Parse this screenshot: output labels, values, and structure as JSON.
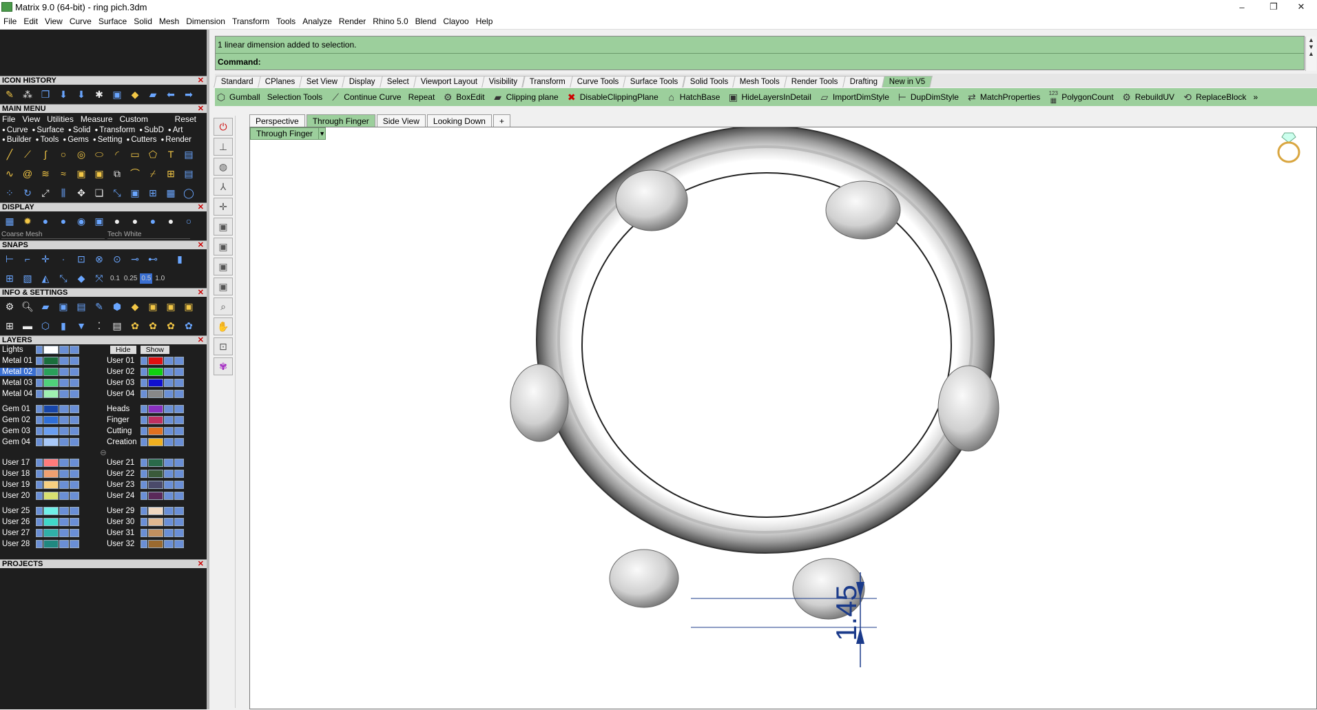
{
  "window": {
    "title": "Matrix 9.0 (64-bit) - ring pich.3dm",
    "controls": {
      "minimize": "–",
      "restore": "❐",
      "close": "✕"
    }
  },
  "menubar": [
    "File",
    "Edit",
    "View",
    "Curve",
    "Surface",
    "Solid",
    "Mesh",
    "Dimension",
    "Transform",
    "Tools",
    "Analyze",
    "Render",
    "Rhino 5.0",
    "Blend",
    "Clayoo",
    "Help"
  ],
  "left_panel": {
    "icon_history": "ICON HISTORY",
    "main_menu": {
      "title": "MAIN MENU",
      "menu": [
        "File",
        "View",
        "Utilities",
        "Measure",
        "Custom"
      ],
      "reset": "Reset",
      "cats_row1": [
        "Curve",
        "Surface",
        "Solid",
        "Transform",
        "SubD",
        "Art"
      ],
      "cats_row2": [
        "Builder",
        "Tools",
        "Gems",
        "Setting",
        "Cutters",
        "Render"
      ]
    },
    "display": {
      "title": "DISPLAY",
      "mesh": "Coarse Mesh",
      "style": "Tech White"
    },
    "snaps": {
      "title": "SNAPS",
      "values": [
        "0.1",
        "0.25",
        "0.5",
        "1.0"
      ]
    },
    "info": "INFO & SETTINGS",
    "layers": {
      "title": "LAYERS",
      "lights": "Lights",
      "hide": "Hide",
      "show": "Show",
      "left": [
        [
          "Metal 01",
          "Metal 02",
          "Metal 03",
          "Metal 04"
        ],
        [
          "Gem 01",
          "Gem 02",
          "Gem 03",
          "Gem 04"
        ],
        [
          "User 17",
          "User 18",
          "User 19",
          "User 20"
        ],
        [
          "User 25",
          "User 26",
          "User 27",
          "User 28"
        ]
      ],
      "right": [
        [
          "User 01",
          "User 02",
          "User 03",
          "User 04"
        ],
        [
          "Heads",
          "Finger",
          "Cutting",
          "Creation"
        ],
        [
          "User 21",
          "User 22",
          "User 23",
          "User 24"
        ],
        [
          "User 29",
          "User 30",
          "User 31",
          "User 32"
        ]
      ],
      "left_colors": [
        [
          "#1a6e3c",
          "#2aa05a",
          "#4fd07a",
          "#9ff0b0"
        ],
        [
          "#1846a8",
          "#2f6fd8",
          "#6a9ef0",
          "#a8c8f8"
        ],
        [
          "#ff7b7b",
          "#f0a070",
          "#f7d080",
          "#d8e070"
        ],
        [
          "#70f0e8",
          "#40d8c8",
          "#30b0a8",
          "#208880"
        ]
      ],
      "right_colors": [
        [
          "#e01010",
          "#10d010",
          "#1010d0",
          "#888888"
        ],
        [
          "#8a30c0",
          "#c03060",
          "#e07020",
          "#f0b020"
        ],
        [
          "#2a6a4a",
          "#3a5a3a",
          "#4a4a6a",
          "#5a2a5a"
        ],
        [
          "#f0d8c0",
          "#e0b890",
          "#c09060",
          "#9a6a30"
        ]
      ],
      "selected": "Metal 02"
    },
    "projects": "PROJECTS"
  },
  "command": {
    "history": "1 linear dimension added to selection.",
    "prompt": "Command:"
  },
  "toolbar_tabs": [
    "Standard",
    "CPlanes",
    "Set View",
    "Display",
    "Select",
    "Viewport Layout",
    "Visibility",
    "Transform",
    "Curve Tools",
    "Surface Tools",
    "Solid Tools",
    "Mesh Tools",
    "Render Tools",
    "Drafting",
    "New in V5"
  ],
  "active_toolbar_tab": "New in V5",
  "tools": [
    {
      "icon": "gumball-icon",
      "label": "Gumball"
    },
    {
      "icon": "",
      "label": "Selection Tools"
    },
    {
      "icon": "curve-icon",
      "label": "Continue Curve"
    },
    {
      "icon": "",
      "label": "Repeat"
    },
    {
      "icon": "boxedit-icon",
      "label": "BoxEdit"
    },
    {
      "icon": "clipping-icon",
      "label": "Clipping plane"
    },
    {
      "icon": "disable-clipping-icon",
      "label": "DisableClippingPlane"
    },
    {
      "icon": "hatch-icon",
      "label": "HatchBase"
    },
    {
      "icon": "layers-icon",
      "label": "HideLayersInDetail"
    },
    {
      "icon": "import-icon",
      "label": "ImportDimStyle"
    },
    {
      "icon": "dupdim-icon",
      "label": "DupDimStyle"
    },
    {
      "icon": "match-icon",
      "label": "MatchProperties"
    },
    {
      "icon": "polycount-icon",
      "label": "PolygonCount"
    },
    {
      "icon": "rebuild-icon",
      "label": "RebuildUV"
    },
    {
      "icon": "replace-icon",
      "label": "ReplaceBlock"
    }
  ],
  "more_glyph": "»",
  "polygon_count_tag": "123",
  "view_tabs": [
    "Perspective",
    "Through Finger",
    "Side View",
    "Looking Down"
  ],
  "active_view": "Through Finger",
  "add_tab": "+",
  "viewport": {
    "label": "Through Finger",
    "dimension": "1.45"
  }
}
